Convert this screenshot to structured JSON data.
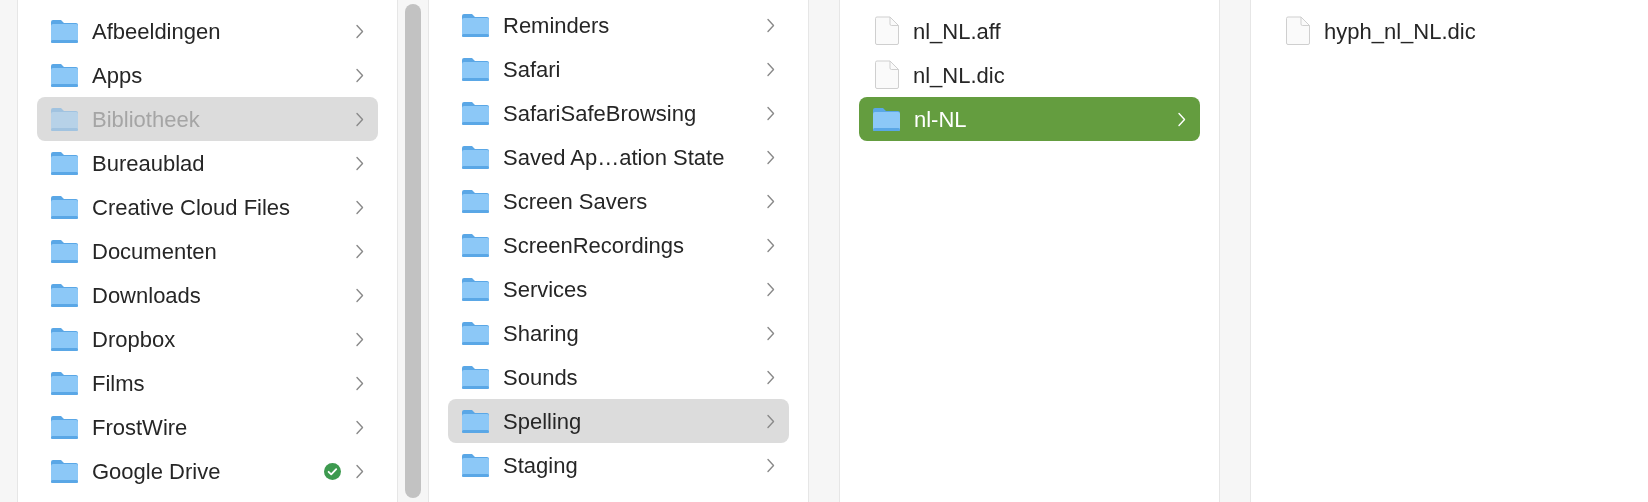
{
  "columns": [
    {
      "scrollbar": true,
      "items": [
        {
          "name": "Afbeeldingen",
          "kind": "folder",
          "selected": false,
          "dimmed": false,
          "synced": false
        },
        {
          "name": "Apps",
          "kind": "folder",
          "selected": false,
          "dimmed": false,
          "synced": false
        },
        {
          "name": "Bibliotheek",
          "kind": "folder",
          "selected": true,
          "dimmed": true,
          "synced": false
        },
        {
          "name": "Bureaublad",
          "kind": "folder",
          "selected": false,
          "dimmed": false,
          "synced": false
        },
        {
          "name": "Creative Cloud Files",
          "kind": "folder",
          "selected": false,
          "dimmed": false,
          "synced": false
        },
        {
          "name": "Documenten",
          "kind": "folder",
          "selected": false,
          "dimmed": false,
          "synced": false
        },
        {
          "name": "Downloads",
          "kind": "folder",
          "selected": false,
          "dimmed": false,
          "synced": false
        },
        {
          "name": "Dropbox",
          "kind": "folder",
          "selected": false,
          "dimmed": false,
          "synced": false
        },
        {
          "name": "Films",
          "kind": "folder",
          "selected": false,
          "dimmed": false,
          "synced": false
        },
        {
          "name": "FrostWire",
          "kind": "folder",
          "selected": false,
          "dimmed": false,
          "synced": false
        },
        {
          "name": "Google Drive",
          "kind": "folder",
          "selected": false,
          "dimmed": false,
          "synced": true
        }
      ]
    },
    {
      "focused": false,
      "items": [
        {
          "name": "Reminders",
          "kind": "folder",
          "selected": false
        },
        {
          "name": "Safari",
          "kind": "folder",
          "selected": false
        },
        {
          "name": "SafariSafeBrowsing",
          "kind": "folder",
          "selected": false
        },
        {
          "name": "Saved Ap…ation State",
          "kind": "folder",
          "selected": false
        },
        {
          "name": "Screen Savers",
          "kind": "folder",
          "selected": false
        },
        {
          "name": "ScreenRecordings",
          "kind": "folder",
          "selected": false
        },
        {
          "name": "Services",
          "kind": "folder",
          "selected": false
        },
        {
          "name": "Sharing",
          "kind": "folder",
          "selected": false
        },
        {
          "name": "Sounds",
          "kind": "folder",
          "selected": false
        },
        {
          "name": "Spelling",
          "kind": "folder",
          "selected": true
        },
        {
          "name": "Staging",
          "kind": "folder",
          "selected": false
        }
      ]
    },
    {
      "focused": true,
      "items": [
        {
          "name": "nl_NL.aff",
          "kind": "file",
          "selected": false
        },
        {
          "name": "nl_NL.dic",
          "kind": "file",
          "selected": false
        },
        {
          "name": "nl-NL",
          "kind": "folder",
          "selected": true
        }
      ]
    },
    {
      "items": [
        {
          "name": "hyph_nl_NL.dic",
          "kind": "file",
          "selected": false
        }
      ]
    }
  ]
}
